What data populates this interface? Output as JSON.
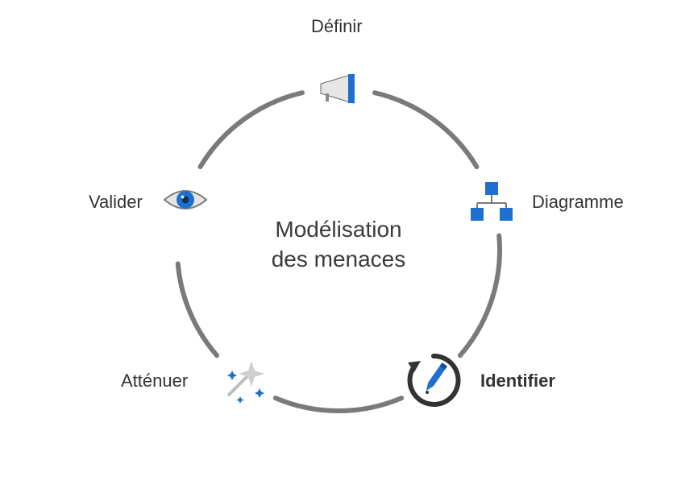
{
  "diagram": {
    "center_line1": "Modélisation",
    "center_line2": "des menaces",
    "steps": {
      "definir": {
        "label": "Définir"
      },
      "diagramme": {
        "label": "Diagramme"
      },
      "identifier": {
        "label": "Identifier"
      },
      "attenuer": {
        "label": "Atténuer"
      },
      "valider": {
        "label": "Valider"
      }
    }
  }
}
